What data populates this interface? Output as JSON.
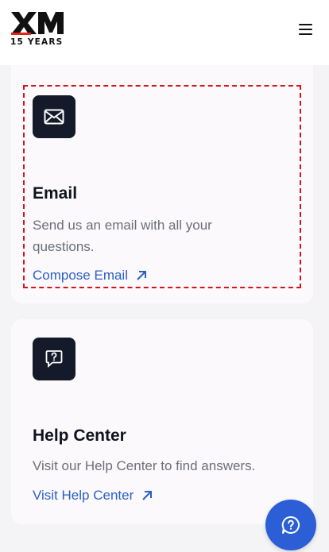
{
  "header": {
    "logo_text": "XM",
    "logo_tagline": "15 YEARS",
    "menu_icon": "hamburger-menu-icon"
  },
  "colors": {
    "brand_red": "#e2231a",
    "icon_box": "#141a29",
    "link": "#2b5fc4",
    "fab": "#2c5fd5",
    "highlight": "#d6141c"
  },
  "email_card": {
    "icon": "envelope-icon",
    "title": "Email",
    "description": "Send us an email with all your questions.",
    "link_label": "Compose Email",
    "link_icon": "arrow-up-right-icon"
  },
  "help_card": {
    "icon": "question-chat-icon",
    "title": "Help Center",
    "description": "Visit our Help Center to find answers.",
    "link_label": "Visit Help Center",
    "link_icon": "arrow-up-right-icon"
  },
  "chat_button": {
    "icon": "chat-help-icon"
  }
}
